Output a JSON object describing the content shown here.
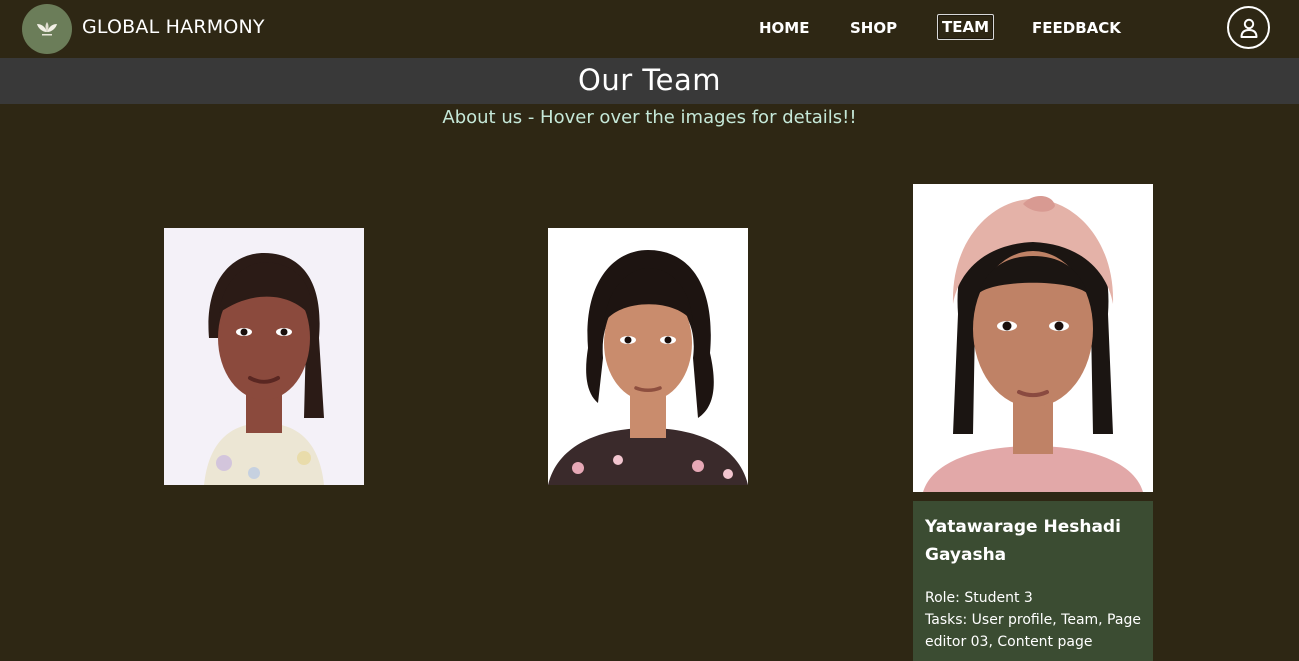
{
  "brand": {
    "name": "GLOBAL HARMONY",
    "logo_icon": "leaf-logo-icon"
  },
  "nav": {
    "items": [
      {
        "label": "HOME",
        "active": false
      },
      {
        "label": "SHOP",
        "active": false
      },
      {
        "label": "TEAM",
        "active": true
      },
      {
        "label": "FEEDBACK",
        "active": false
      }
    ],
    "profile_icon": "user-profile-icon"
  },
  "page": {
    "title": "Our Team",
    "subtitle": "About us - Hover over the images for details!!"
  },
  "team": {
    "members": [
      {
        "photo": "member-1-photo",
        "background": "#f4f1f8",
        "hair": "#2b1b16",
        "skin": "#8b4a3d",
        "clothing": "#ece6d4"
      },
      {
        "photo": "member-2-photo",
        "background": "#ffffff",
        "hair": "#1d1411",
        "skin": "#c98c6d",
        "clothing": "#3a2a2b"
      },
      {
        "photo": "member-3-photo",
        "background": "#ffffff",
        "hair": "#1b1512",
        "skin": "#bf8266",
        "clothing": "#e2a8a8"
      }
    ],
    "detail": {
      "name": "Yatawarage Heshadi Gayasha",
      "role": "Role: Student 3",
      "tasks": "Tasks: User profile, Team, Page editor 03, Content page"
    }
  },
  "colors": {
    "page_background": "#2e2714",
    "title_bar": "#393939",
    "subtitle_text": "#c5e8d8",
    "card_background": "#3b4c32",
    "logo_background": "#6b7d59"
  }
}
